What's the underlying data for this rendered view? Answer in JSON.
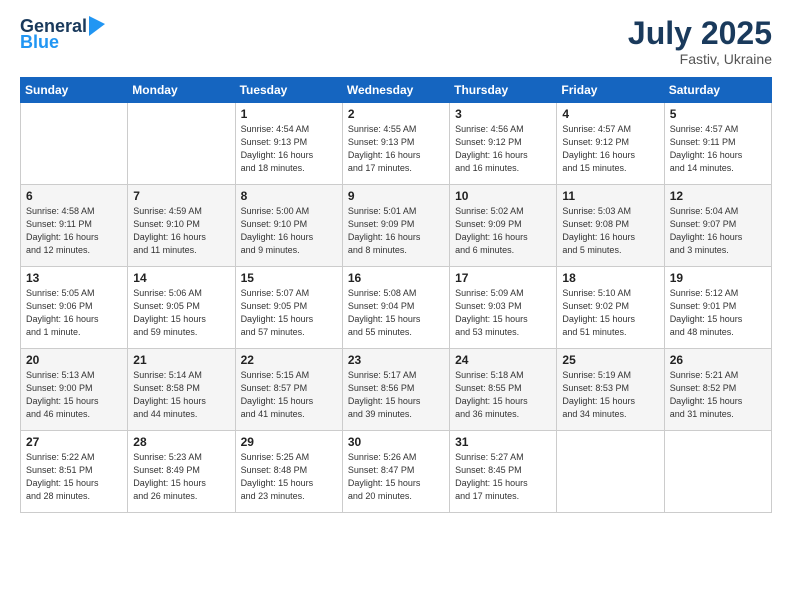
{
  "header": {
    "logo_general": "General",
    "logo_blue": "Blue",
    "month": "July 2025",
    "location": "Fastiv, Ukraine"
  },
  "weekdays": [
    "Sunday",
    "Monday",
    "Tuesday",
    "Wednesday",
    "Thursday",
    "Friday",
    "Saturday"
  ],
  "weeks": [
    [
      {
        "day": "",
        "info": ""
      },
      {
        "day": "",
        "info": ""
      },
      {
        "day": "1",
        "info": "Sunrise: 4:54 AM\nSunset: 9:13 PM\nDaylight: 16 hours\nand 18 minutes."
      },
      {
        "day": "2",
        "info": "Sunrise: 4:55 AM\nSunset: 9:13 PM\nDaylight: 16 hours\nand 17 minutes."
      },
      {
        "day": "3",
        "info": "Sunrise: 4:56 AM\nSunset: 9:12 PM\nDaylight: 16 hours\nand 16 minutes."
      },
      {
        "day": "4",
        "info": "Sunrise: 4:57 AM\nSunset: 9:12 PM\nDaylight: 16 hours\nand 15 minutes."
      },
      {
        "day": "5",
        "info": "Sunrise: 4:57 AM\nSunset: 9:11 PM\nDaylight: 16 hours\nand 14 minutes."
      }
    ],
    [
      {
        "day": "6",
        "info": "Sunrise: 4:58 AM\nSunset: 9:11 PM\nDaylight: 16 hours\nand 12 minutes."
      },
      {
        "day": "7",
        "info": "Sunrise: 4:59 AM\nSunset: 9:10 PM\nDaylight: 16 hours\nand 11 minutes."
      },
      {
        "day": "8",
        "info": "Sunrise: 5:00 AM\nSunset: 9:10 PM\nDaylight: 16 hours\nand 9 minutes."
      },
      {
        "day": "9",
        "info": "Sunrise: 5:01 AM\nSunset: 9:09 PM\nDaylight: 16 hours\nand 8 minutes."
      },
      {
        "day": "10",
        "info": "Sunrise: 5:02 AM\nSunset: 9:09 PM\nDaylight: 16 hours\nand 6 minutes."
      },
      {
        "day": "11",
        "info": "Sunrise: 5:03 AM\nSunset: 9:08 PM\nDaylight: 16 hours\nand 5 minutes."
      },
      {
        "day": "12",
        "info": "Sunrise: 5:04 AM\nSunset: 9:07 PM\nDaylight: 16 hours\nand 3 minutes."
      }
    ],
    [
      {
        "day": "13",
        "info": "Sunrise: 5:05 AM\nSunset: 9:06 PM\nDaylight: 16 hours\nand 1 minute."
      },
      {
        "day": "14",
        "info": "Sunrise: 5:06 AM\nSunset: 9:05 PM\nDaylight: 15 hours\nand 59 minutes."
      },
      {
        "day": "15",
        "info": "Sunrise: 5:07 AM\nSunset: 9:05 PM\nDaylight: 15 hours\nand 57 minutes."
      },
      {
        "day": "16",
        "info": "Sunrise: 5:08 AM\nSunset: 9:04 PM\nDaylight: 15 hours\nand 55 minutes."
      },
      {
        "day": "17",
        "info": "Sunrise: 5:09 AM\nSunset: 9:03 PM\nDaylight: 15 hours\nand 53 minutes."
      },
      {
        "day": "18",
        "info": "Sunrise: 5:10 AM\nSunset: 9:02 PM\nDaylight: 15 hours\nand 51 minutes."
      },
      {
        "day": "19",
        "info": "Sunrise: 5:12 AM\nSunset: 9:01 PM\nDaylight: 15 hours\nand 48 minutes."
      }
    ],
    [
      {
        "day": "20",
        "info": "Sunrise: 5:13 AM\nSunset: 9:00 PM\nDaylight: 15 hours\nand 46 minutes."
      },
      {
        "day": "21",
        "info": "Sunrise: 5:14 AM\nSunset: 8:58 PM\nDaylight: 15 hours\nand 44 minutes."
      },
      {
        "day": "22",
        "info": "Sunrise: 5:15 AM\nSunset: 8:57 PM\nDaylight: 15 hours\nand 41 minutes."
      },
      {
        "day": "23",
        "info": "Sunrise: 5:17 AM\nSunset: 8:56 PM\nDaylight: 15 hours\nand 39 minutes."
      },
      {
        "day": "24",
        "info": "Sunrise: 5:18 AM\nSunset: 8:55 PM\nDaylight: 15 hours\nand 36 minutes."
      },
      {
        "day": "25",
        "info": "Sunrise: 5:19 AM\nSunset: 8:53 PM\nDaylight: 15 hours\nand 34 minutes."
      },
      {
        "day": "26",
        "info": "Sunrise: 5:21 AM\nSunset: 8:52 PM\nDaylight: 15 hours\nand 31 minutes."
      }
    ],
    [
      {
        "day": "27",
        "info": "Sunrise: 5:22 AM\nSunset: 8:51 PM\nDaylight: 15 hours\nand 28 minutes."
      },
      {
        "day": "28",
        "info": "Sunrise: 5:23 AM\nSunset: 8:49 PM\nDaylight: 15 hours\nand 26 minutes."
      },
      {
        "day": "29",
        "info": "Sunrise: 5:25 AM\nSunset: 8:48 PM\nDaylight: 15 hours\nand 23 minutes."
      },
      {
        "day": "30",
        "info": "Sunrise: 5:26 AM\nSunset: 8:47 PM\nDaylight: 15 hours\nand 20 minutes."
      },
      {
        "day": "31",
        "info": "Sunrise: 5:27 AM\nSunset: 8:45 PM\nDaylight: 15 hours\nand 17 minutes."
      },
      {
        "day": "",
        "info": ""
      },
      {
        "day": "",
        "info": ""
      }
    ]
  ]
}
